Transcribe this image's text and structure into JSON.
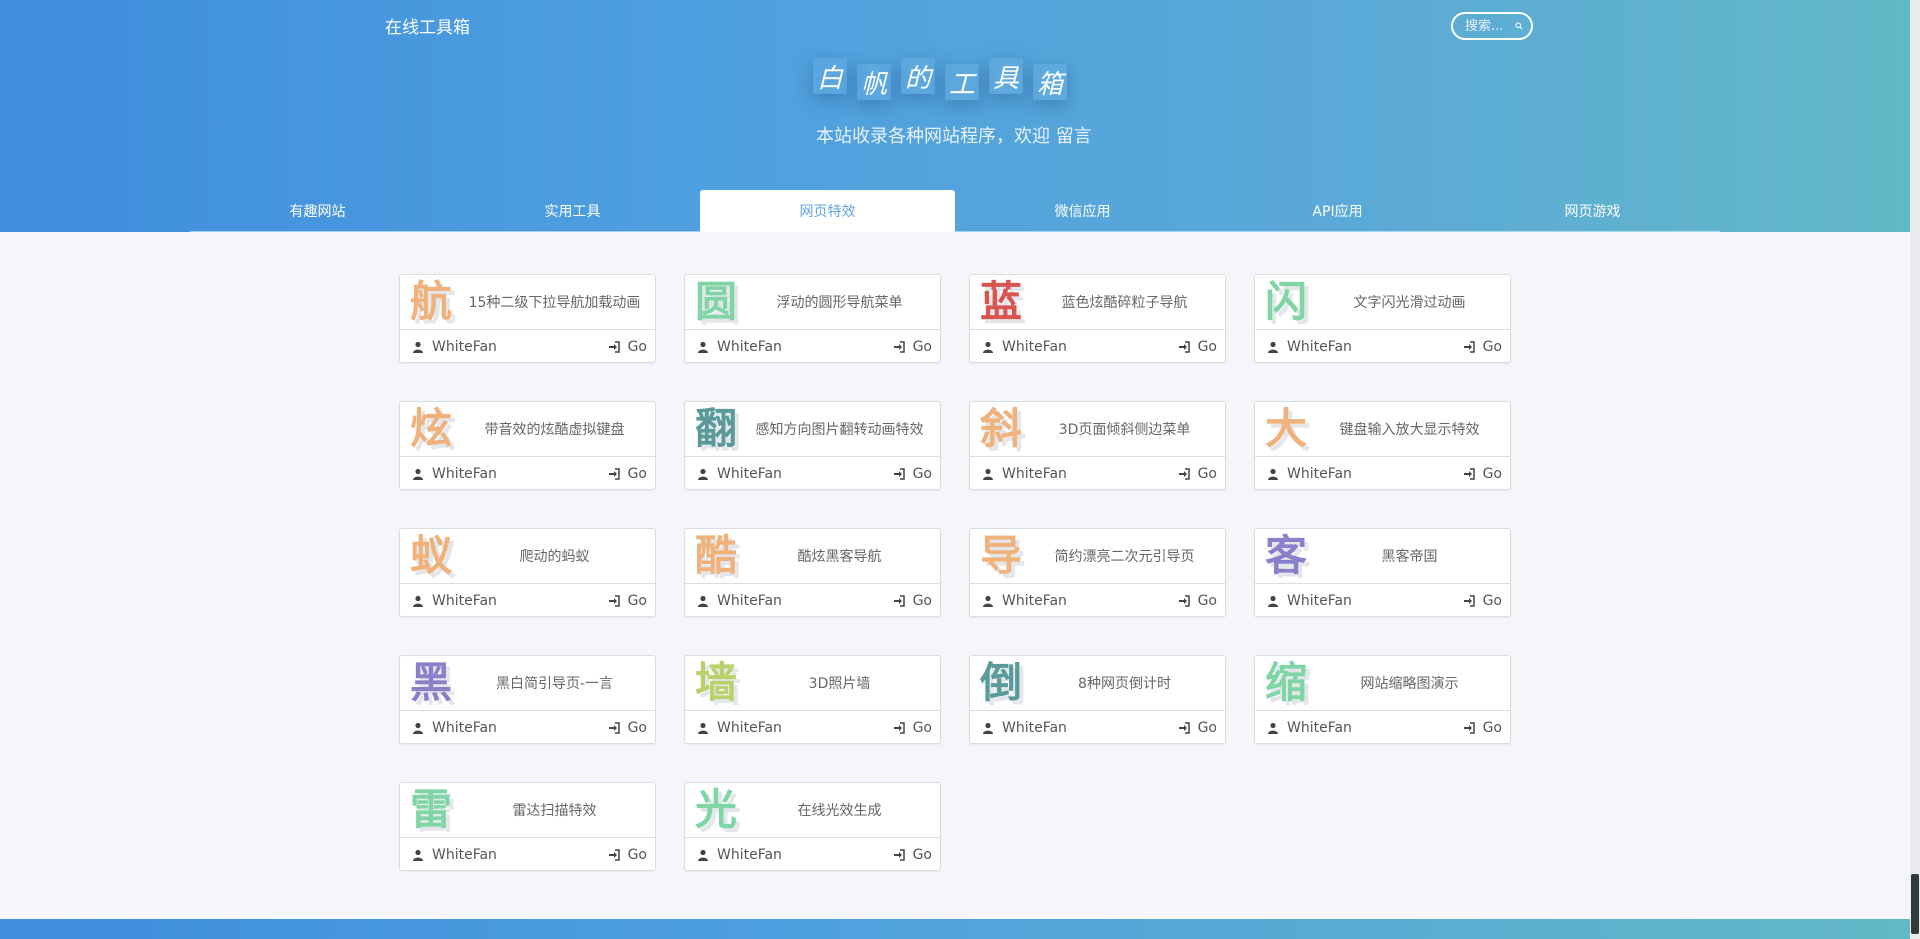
{
  "header": {
    "brand": "在线工具箱",
    "search_placeholder": "搜索...",
    "title_chars": [
      "白",
      "帆",
      "的",
      "工",
      "具",
      "箱"
    ],
    "subtitle": "本站收录各种网站程序，欢迎 留言"
  },
  "tabs": [
    {
      "label": "有趣网站",
      "active": false
    },
    {
      "label": "实用工具",
      "active": false
    },
    {
      "label": "网页特效",
      "active": true
    },
    {
      "label": "微信应用",
      "active": false
    },
    {
      "label": "API应用",
      "active": false
    },
    {
      "label": "网页游戏",
      "active": false
    }
  ],
  "cards": [
    {
      "glyph": "航",
      "color": "#f0b27a",
      "title": "15种二级下拉导航加载动画",
      "author": "WhiteFan",
      "go": "Go"
    },
    {
      "glyph": "圆",
      "color": "#7fd6a4",
      "title": "浮动的圆形导航菜单",
      "author": "WhiteFan",
      "go": "Go"
    },
    {
      "glyph": "蓝",
      "color": "#d9534f",
      "title": "蓝色炫酷碎粒子导航",
      "author": "WhiteFan",
      "go": "Go"
    },
    {
      "glyph": "闪",
      "color": "#7fd6a4",
      "title": "文字闪光滑过动画",
      "author": "WhiteFan",
      "go": "Go"
    },
    {
      "glyph": "炫",
      "color": "#f0b27a",
      "title": "带音效的炫酷虚拟键盘",
      "author": "WhiteFan",
      "go": "Go"
    },
    {
      "glyph": "翻",
      "color": "#5a9a9a",
      "title": "感知方向图片翻转动画特效",
      "author": "WhiteFan",
      "go": "Go"
    },
    {
      "glyph": "斜",
      "color": "#f0b27a",
      "title": "3D页面倾斜侧边菜单",
      "author": "WhiteFan",
      "go": "Go"
    },
    {
      "glyph": "大",
      "color": "#f0b27a",
      "title": "键盘输入放大显示特效",
      "author": "WhiteFan",
      "go": "Go"
    },
    {
      "glyph": "蚁",
      "color": "#f0b27a",
      "title": "爬动的蚂蚁",
      "author": "WhiteFan",
      "go": "Go"
    },
    {
      "glyph": "酷",
      "color": "#f0b27a",
      "title": "酷炫黑客导航",
      "author": "WhiteFan",
      "go": "Go"
    },
    {
      "glyph": "导",
      "color": "#f0b27a",
      "title": "简约漂亮二次元引导页",
      "author": "WhiteFan",
      "go": "Go"
    },
    {
      "glyph": "客",
      "color": "#8a7fc9",
      "title": "黑客帝国",
      "author": "WhiteFan",
      "go": "Go"
    },
    {
      "glyph": "黑",
      "color": "#8a7fc9",
      "title": "黑白简引导页-一言",
      "author": "WhiteFan",
      "go": "Go"
    },
    {
      "glyph": "墙",
      "color": "#b9d16a",
      "title": "3D照片墙",
      "author": "WhiteFan",
      "go": "Go"
    },
    {
      "glyph": "倒",
      "color": "#5a9a9a",
      "title": "8种网页倒计时",
      "author": "WhiteFan",
      "go": "Go"
    },
    {
      "glyph": "缩",
      "color": "#7fd6a4",
      "title": "网站缩略图演示",
      "author": "WhiteFan",
      "go": "Go"
    },
    {
      "glyph": "雷",
      "color": "#7fd6a4",
      "title": "雷达扫描特效",
      "author": "WhiteFan",
      "go": "Go"
    },
    {
      "glyph": "光",
      "color": "#7fd6a4",
      "title": "在线光效生成",
      "author": "WhiteFan",
      "go": "Go"
    }
  ]
}
